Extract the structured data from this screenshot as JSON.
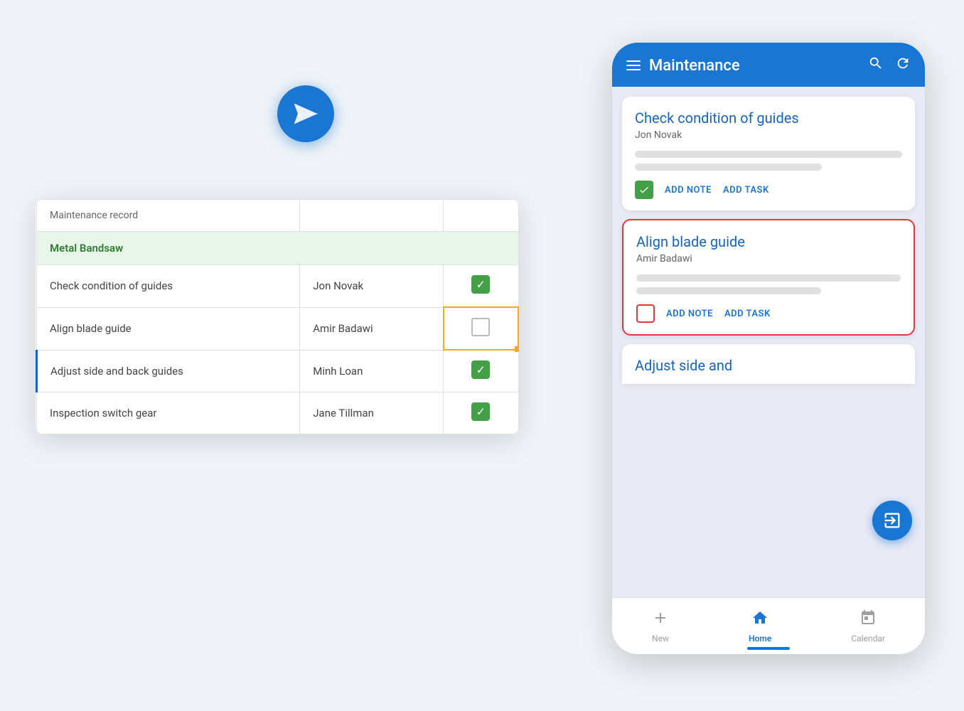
{
  "app": {
    "title": "Maintenance"
  },
  "spreadsheet": {
    "maintenance_record_label": "Maintenance record",
    "section_header": "Metal Bandsaw",
    "rows": [
      {
        "task": "Check condition of guides",
        "assignee": "Jon Novak",
        "status": "checked"
      },
      {
        "task": "Align blade guide",
        "assignee": "Amir Badawi",
        "status": "empty"
      },
      {
        "task": "Adjust side and back guides",
        "assignee": "Minh Loan",
        "status": "checked"
      },
      {
        "task": "Inspection switch gear",
        "assignee": "Jane Tillman",
        "status": "checked"
      }
    ]
  },
  "mobile": {
    "header": {
      "title": "Maintenance",
      "search_label": "search",
      "refresh_label": "refresh"
    },
    "cards": [
      {
        "id": "card1",
        "title": "Check condition of guides",
        "person": "Jon Novak",
        "checked": true,
        "add_note": "ADD NOTE",
        "add_task": "ADD TASK"
      },
      {
        "id": "card2",
        "title": "Align blade guide",
        "person": "Amir Badawi",
        "checked": false,
        "add_note": "ADD NOTE",
        "add_task": "ADD TASK",
        "selected": true
      }
    ],
    "partial_card_title": "Adjust side and",
    "bottom_nav": {
      "new_label": "New",
      "home_label": "Home",
      "calendar_label": "Calendar"
    }
  }
}
